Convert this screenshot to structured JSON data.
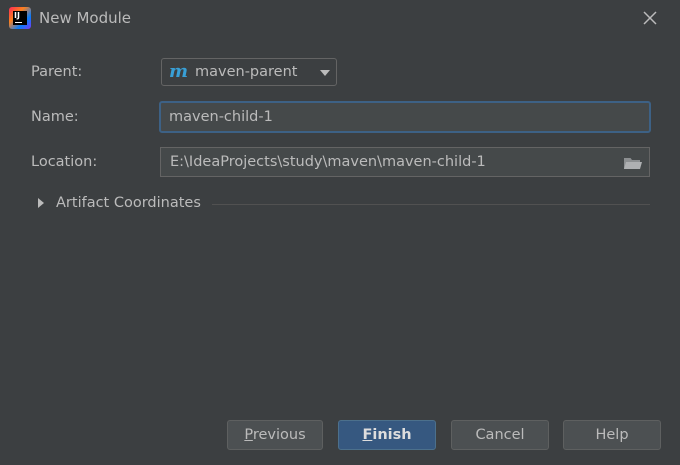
{
  "window": {
    "title": "New Module"
  },
  "form": {
    "parent_label": "Parent:",
    "parent_value": "maven-parent",
    "name_label": "Name:",
    "name_value": "maven-child-1",
    "location_label": "Location:",
    "location_value": "E:\\IdeaProjects\\study\\maven\\maven-child-1"
  },
  "artifact": {
    "label": "Artifact Coordinates"
  },
  "buttons": {
    "previous_mnemonic": "P",
    "previous_rest": "revious",
    "finish_mnemonic": "F",
    "finish_rest": "inish",
    "cancel": "Cancel",
    "help": "Help"
  },
  "colors": {
    "background": "#3c3f41",
    "accent_focus": "#3d6185",
    "primary_button": "#365880",
    "maven_icon": "#389fd6"
  },
  "icons": {
    "app": "intellij-idea-icon",
    "close": "close-icon",
    "parent": "maven-module-icon",
    "dropdown": "chevron-down-icon",
    "browse": "folder-icon",
    "expand": "expand-triangle-icon"
  }
}
